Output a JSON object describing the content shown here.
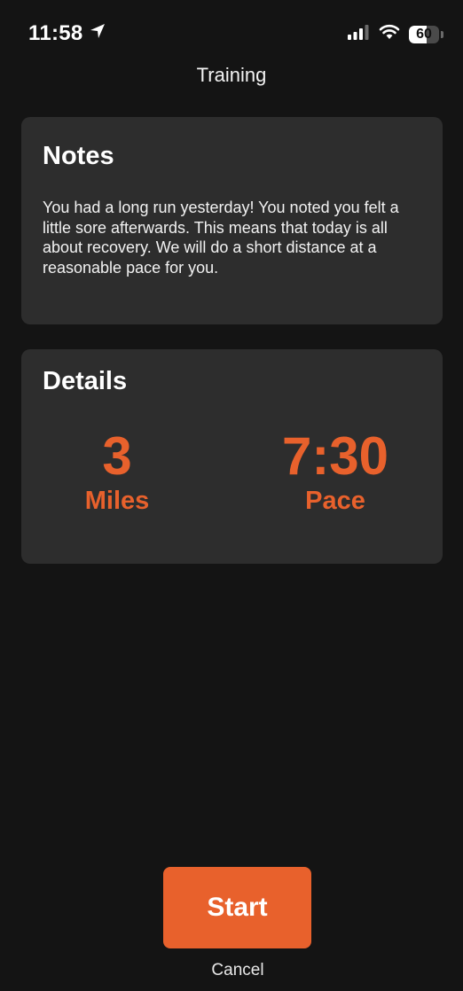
{
  "status_bar": {
    "time": "11:58",
    "battery_level": "60",
    "battery_fraction": 0.6
  },
  "header": {
    "title": "Training"
  },
  "notes": {
    "title": "Notes",
    "body": "You had a long run yesterday! You noted you felt a little sore afterwards. This means that today is all about recovery. We will do a short distance at a reasonable pace for you."
  },
  "details": {
    "title": "Details",
    "distance_value": "3",
    "distance_label": "Miles",
    "pace_value": "7:30",
    "pace_label": "Pace"
  },
  "actions": {
    "start_label": "Start",
    "cancel_label": "Cancel"
  },
  "colors": {
    "background": "#141414",
    "card": "#2d2d2d",
    "accent": "#e8612c"
  },
  "icons": {
    "location": "location-arrow-icon",
    "signal": "cellular-signal-icon",
    "wifi": "wifi-icon",
    "battery": "battery-icon"
  }
}
